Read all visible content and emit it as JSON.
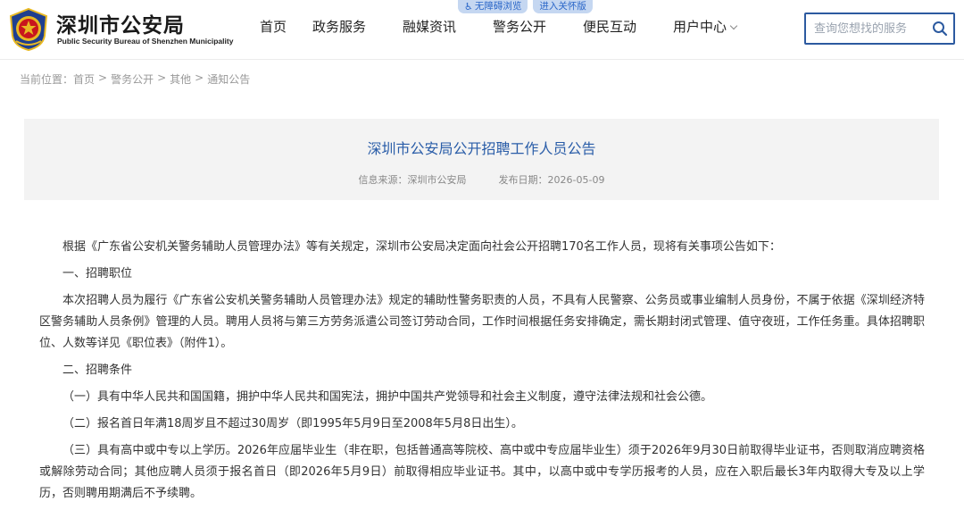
{
  "header": {
    "logo_cn": "深圳市公安局",
    "logo_en": "Public Security Bureau of Shenzhen Municipality",
    "accessibility": {
      "barrier_free": "无障碍浏览",
      "elderly": "进入关怀版"
    },
    "nav": [
      "首页",
      "政务服务",
      "融媒资讯",
      "警务公开",
      "便民互动",
      "用户中心"
    ],
    "search_placeholder": "查询您想找的服务"
  },
  "breadcrumb": [
    "当前位置：首页",
    ">",
    "警务公开",
    ">",
    "其他",
    ">",
    "通知公告"
  ],
  "article": {
    "title": "深圳市公安局公开招聘工作人员公告",
    "source": "信息来源：深圳市公安局",
    "date": "发布日期：2026-05-09",
    "paragraphs": [
      "根据《广东省公安机关警务辅助人员管理办法》等有关规定，深圳市公安局决定面向社会公开招聘170名工作人员，现将有关事项公告如下：",
      "一、招聘职位",
      "本次招聘人员为履行《广东省公安机关警务辅助人员管理办法》规定的辅助性警务职责的人员，不具有人民警察、公务员或事业编制人员身份，不属于依据《深圳经济特区警务辅助人员条例》管理的人员。聘用人员将与第三方劳务派遣公司签订劳动合同，工作时间根据任务安排确定，需长期封闭式管理、值守夜班，工作任务重。具体招聘职位、人数等详见《职位表》（附件1）。",
      "二、招聘条件",
      "（一）具有中华人民共和国国籍，拥护中华人民共和国宪法，拥护中国共产党领导和社会主义制度，遵守法律法规和社会公德。",
      "（二）报名首日年满18周岁且不超过30周岁（即1995年5月9日至2008年5月8日出生）。",
      "（三）具有高中或中专以上学历。2026年应届毕业生（非在职，包括普通高等院校、高中或中专应届毕业生）须于2026年9月30日前取得毕业证书，否则取消应聘资格或解除劳动合同；其他应聘人员须于报名首日（即2026年5月9日）前取得相应毕业证书。其中，以高中或中专学历报考的人员，应在入职后最长3年内取得大专及以上学历，否则聘用期满后不予续聘。"
    ]
  },
  "colors": {
    "brand_blue": "#2a5da8",
    "search_border": "#2c5aa0",
    "emblem_red": "#c8161d",
    "emblem_gold": "#e8b923"
  }
}
